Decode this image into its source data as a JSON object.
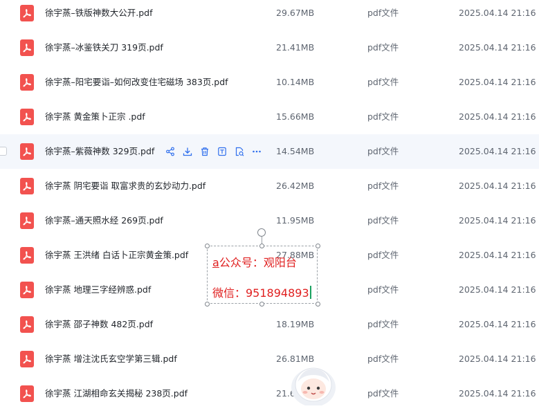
{
  "files": [
    {
      "name": "徐宇蒸–铁版神数大公开.pdf",
      "size": "29.67MB",
      "type": "pdf文件",
      "date": "2025.04.14 21:16"
    },
    {
      "name": "徐宇蒸–冰鉴铁关刀 319页.pdf",
      "size": "21.41MB",
      "type": "pdf文件",
      "date": "2025.04.14 21:16"
    },
    {
      "name": "徐宇蒸–阳宅要诣–如何改变住宅磁场 383页.pdf",
      "size": "10.14MB",
      "type": "pdf文件",
      "date": "2025.04.14 21:16"
    },
    {
      "name": "徐宇蒸 黄金策卜正宗 .pdf",
      "size": "15.66MB",
      "type": "pdf文件",
      "date": "2025.04.14 21:16"
    },
    {
      "name": "徐宇蒸–紫薇神数 329页.pdf",
      "size": "14.54MB",
      "type": "pdf文件",
      "date": "2025.04.14 21:16"
    },
    {
      "name": "徐宇蒸 阴宅要诣 取富求贵的玄妙动力.pdf",
      "size": "26.42MB",
      "type": "pdf文件",
      "date": "2025.04.14 21:16"
    },
    {
      "name": "徐宇蒸–通天照水经 269页.pdf",
      "size": "11.95MB",
      "type": "pdf文件",
      "date": "2025.04.14 21:16"
    },
    {
      "name": "徐宇蒸 王洪绪 白话卜正宗黄金策.pdf",
      "size": "27.88MB",
      "type": "pdf文件",
      "date": "2025.04.14 21:16"
    },
    {
      "name": "徐宇蒸 地理三字经辨惑.pdf",
      "size": "",
      "type": "pdf文件",
      "date": "2025.04.14 21:16"
    },
    {
      "name": "徐宇蒸 邵子神数 482页.pdf",
      "size": "18.19MB",
      "type": "pdf文件",
      "date": "2025.04.14 21:16"
    },
    {
      "name": "徐宇蒸 增注沈氏玄空学第三辑.pdf",
      "size": "26.81MB",
      "type": "pdf文件",
      "date": "2025.04.14 21:16"
    },
    {
      "name": "徐宇蒸 江湖相命玄关揭秘 238页.pdf",
      "size": "21.6",
      "type": "pdf文件",
      "date": "2025.04.14 21:16"
    }
  ],
  "hover_row_actions": [
    "share-icon",
    "download-icon",
    "delete-icon",
    "preview-icon",
    "extract-text-icon",
    "more-icon"
  ],
  "watermark": {
    "line1_prefix": "a",
    "line1_rest": "公众号：观阳台",
    "line2": "微信：951894893"
  },
  "colors": {
    "pdf_icon": "#f2524f",
    "hover_row": "#f4f7fc",
    "action_icon": "#2f6fed",
    "watermark_text": "#e02020"
  }
}
